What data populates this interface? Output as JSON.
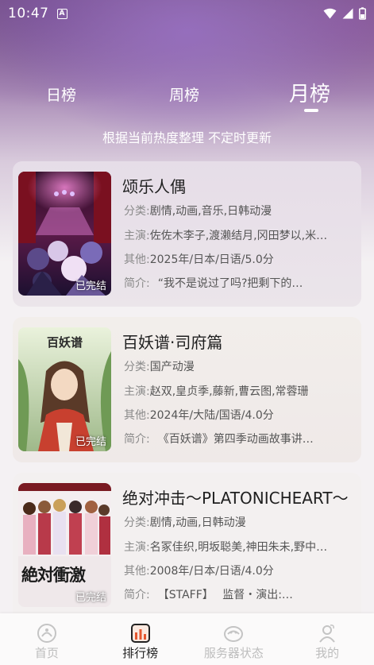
{
  "status_bar": {
    "time": "10:47",
    "notif_letter": "A"
  },
  "tabs": [
    {
      "label": "日榜",
      "active": false
    },
    {
      "label": "周榜",
      "active": false
    },
    {
      "label": "月榜",
      "active": true
    }
  ],
  "subtitle": "根据当前热度整理 不定时更新",
  "items": [
    {
      "title": "颂乐人偶",
      "badge": "已完结",
      "category_label": "分类:",
      "category": "剧情,动画,音乐,日韩动漫",
      "cast_label": "主演:",
      "cast": "佐佐木李子,渡濑结月,冈田梦以,米…",
      "other_label": "其他:",
      "other": "2025年/日本/日语/5.0分",
      "desc_label": "简介:",
      "desc": "“我不是说过了吗?把剩下的…"
    },
    {
      "title": "百妖谱·司府篇",
      "badge": "已完结",
      "category_label": "分类:",
      "category": "国产动漫",
      "cast_label": "主演:",
      "cast": "赵双,皇贞季,藤新,曹云图,常蓉珊",
      "other_label": "其他:",
      "other": "2024年/大陆/国语/4.0分",
      "desc_label": "简介:",
      "desc": "《百妖谱》第四季动画故事讲…"
    },
    {
      "title": "绝对冲击～PLATONICHEART～",
      "badge": "已完结",
      "category_label": "分类:",
      "category": "剧情,动画,日韩动漫",
      "cast_label": "主演:",
      "cast": "名冢佳织,明坂聪美,神田朱未,野中…",
      "other_label": "其他:",
      "other": "2008年/日本/日语/4.0分",
      "desc_label": "简介:",
      "desc": "【STAFF】　 监督・演出:…"
    }
  ],
  "cover_art": {
    "item2_logo": "百妖谱",
    "item3_logo": "絶対衝激"
  },
  "bottom_nav": [
    {
      "label": "首页",
      "icon": "home-icon",
      "active": false
    },
    {
      "label": "排行榜",
      "icon": "ranking-icon",
      "active": true
    },
    {
      "label": "服务器状态",
      "icon": "server-status-icon",
      "active": false
    },
    {
      "label": "我的",
      "icon": "profile-icon",
      "active": false
    }
  ],
  "colors": {
    "accent": "#222222",
    "inactive": "#bdbdbd",
    "header_purple": "#8d6aa0"
  }
}
